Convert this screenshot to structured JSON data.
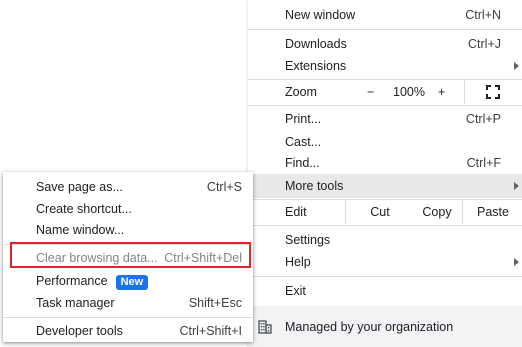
{
  "colors": {
    "accent_blue": "#1a73e8",
    "highlight_red": "#e0262c",
    "hover_bg": "#e8e8e8",
    "footer_bg": "#f1f3f4"
  },
  "main_menu": {
    "new_window": {
      "label": "New window",
      "shortcut": "Ctrl+N"
    },
    "downloads": {
      "label": "Downloads",
      "shortcut": "Ctrl+J"
    },
    "extensions": {
      "label": "Extensions",
      "icon": "chevron-right-icon"
    },
    "zoom": {
      "label": "Zoom",
      "minus": "−",
      "value": "100%",
      "plus": "+",
      "fullscreen_icon": "fullscreen-icon"
    },
    "print": {
      "label": "Print...",
      "shortcut": "Ctrl+P"
    },
    "cast": {
      "label": "Cast..."
    },
    "find": {
      "label": "Find...",
      "shortcut": "Ctrl+F"
    },
    "more_tools": {
      "label": "More tools",
      "icon": "chevron-right-icon"
    },
    "edit": {
      "label": "Edit",
      "cut": "Cut",
      "copy": "Copy",
      "paste": "Paste"
    },
    "settings": {
      "label": "Settings"
    },
    "help": {
      "label": "Help",
      "icon": "chevron-right-icon"
    },
    "exit": {
      "label": "Exit"
    },
    "managed": {
      "label": "Managed by your organization",
      "icon": "building-icon"
    }
  },
  "sub_menu": {
    "save_page": {
      "label": "Save page as...",
      "shortcut": "Ctrl+S"
    },
    "create_shortcut": {
      "label": "Create shortcut..."
    },
    "name_window": {
      "label": "Name window..."
    },
    "clear_browsing": {
      "label": "Clear browsing data...",
      "shortcut": "Ctrl+Shift+Del"
    },
    "performance": {
      "label": "Performance",
      "badge": "New"
    },
    "task_manager": {
      "label": "Task manager",
      "shortcut": "Shift+Esc"
    },
    "developer_tools": {
      "label": "Developer tools",
      "shortcut": "Ctrl+Shift+I"
    }
  }
}
